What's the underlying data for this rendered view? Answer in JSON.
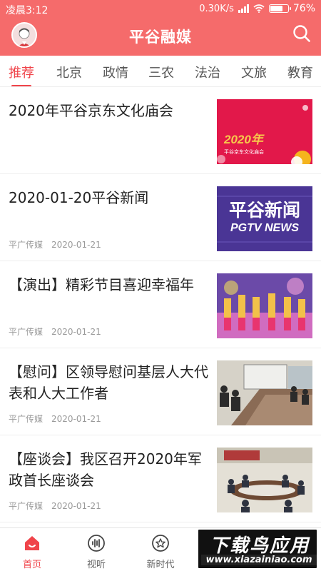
{
  "statusbar": {
    "time": "凌晨3:12",
    "network_speed": "0.30K/s",
    "battery_text": "76%",
    "battery_level": 0.76
  },
  "header": {
    "title": "平谷融媒",
    "color": "#f56b6b"
  },
  "tabs": [
    {
      "label": "推荐",
      "active": true
    },
    {
      "label": "北京",
      "active": false
    },
    {
      "label": "政情",
      "active": false
    },
    {
      "label": "三农",
      "active": false
    },
    {
      "label": "法治",
      "active": false
    },
    {
      "label": "文旅",
      "active": false
    },
    {
      "label": "教育",
      "active": false
    }
  ],
  "articles": [
    {
      "title": "2020年平谷京东文化庙会",
      "source": "",
      "date": "",
      "thumbnail": {
        "icon": "temple-fair-poster",
        "text": "2020年",
        "subtext": "平谷京东文化庙会"
      }
    },
    {
      "title": "2020-01-20平谷新闻",
      "source": "平广传媒",
      "date": "2020-01-21",
      "thumbnail": {
        "icon": "pgtv-news-logo",
        "text": "平谷新闻",
        "subtext": "PGTV NEWS"
      }
    },
    {
      "title": "【演出】精彩节目喜迎幸福年",
      "source": "平广传媒",
      "date": "2020-01-21",
      "thumbnail": {
        "icon": "stage-performance-photo"
      }
    },
    {
      "title": "【慰问】区领导慰问基层人大代表和人大工作者",
      "source": "平广传媒",
      "date": "2020-01-21",
      "thumbnail": {
        "icon": "meeting-room-photo"
      }
    },
    {
      "title": "【座谈会】我区召开2020年军政首长座谈会",
      "source": "平广传媒",
      "date": "2020-01-21",
      "thumbnail": {
        "icon": "conference-photo"
      }
    }
  ],
  "bottom_nav": [
    {
      "label": "首页",
      "icon": "home-icon",
      "active": true
    },
    {
      "label": "视听",
      "icon": "audio-icon",
      "active": false
    },
    {
      "label": "新时代",
      "icon": "new-era-icon",
      "active": false
    }
  ],
  "watermark": {
    "big": "下载鸟应用",
    "small": "www.xiazainiao.com"
  }
}
